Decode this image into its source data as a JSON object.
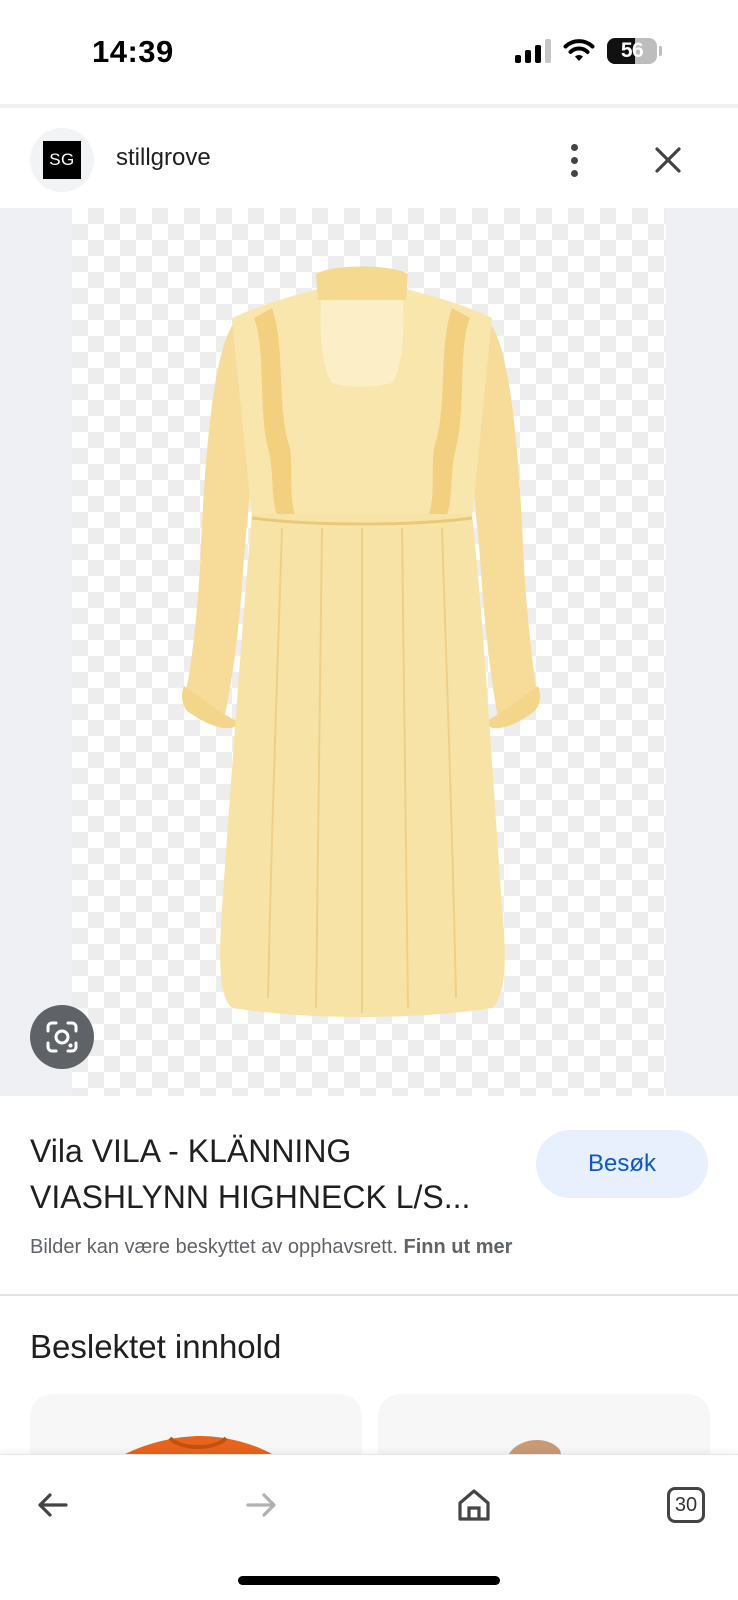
{
  "status_bar": {
    "time": "14:39",
    "battery": "56",
    "icons": [
      "signal-icon",
      "wifi-icon",
      "battery-icon"
    ]
  },
  "source": {
    "avatar_text": "SG",
    "name": "stillgrove"
  },
  "header_icons": [
    "more-vert-icon",
    "close-icon"
  ],
  "image": {
    "subject": "yellow dress",
    "lens_icon": "google-lens-icon"
  },
  "product": {
    "title": "Vila VILA - KLÄNNING VIASHLYNN HIGHNECK L/S...",
    "visit_label": "Besøk",
    "copyright_text": "Bilder kan være beskyttet av opphavsrett.",
    "copyright_link": "Finn ut mer"
  },
  "related": {
    "title": "Beslektet innhold"
  },
  "bottom_nav": {
    "tab_count": "30",
    "icons": [
      "back-arrow-icon",
      "forward-arrow-icon",
      "home-icon",
      "tabs-icon"
    ]
  },
  "colors": {
    "visit_bg": "#e8f0fe",
    "visit_text": "#0b57d0",
    "dress": "#f8e3a6",
    "image_bg": "#eef0f3"
  }
}
